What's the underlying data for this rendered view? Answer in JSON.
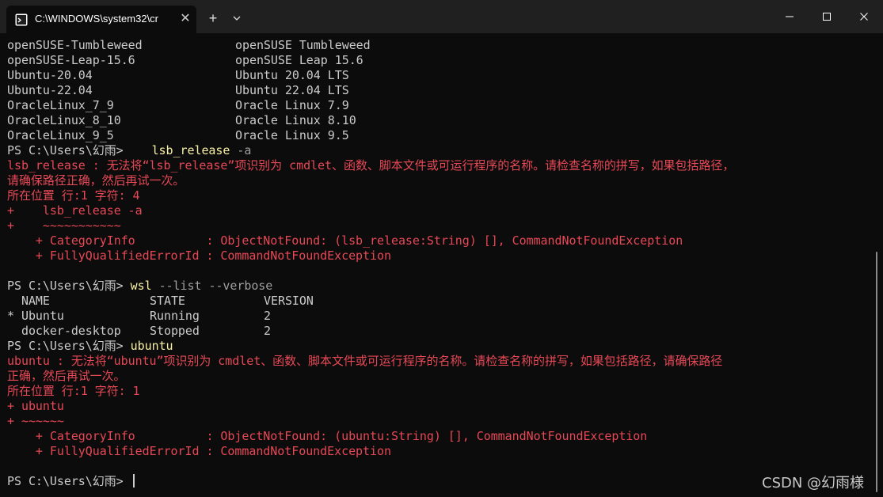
{
  "window": {
    "tab_title": "C:\\WINDOWS\\system32\\cr",
    "close_glyph": "✕",
    "new_tab_glyph": "+"
  },
  "distros": [
    {
      "name": "openSUSE-Tumbleweed",
      "friendly": "openSUSE Tumbleweed"
    },
    {
      "name": "openSUSE-Leap-15.6",
      "friendly": "openSUSE Leap 15.6"
    },
    {
      "name": "Ubuntu-20.04",
      "friendly": "Ubuntu 20.04 LTS"
    },
    {
      "name": "Ubuntu-22.04",
      "friendly": "Ubuntu 22.04 LTS"
    },
    {
      "name": "OracleLinux_7_9",
      "friendly": "Oracle Linux 7.9"
    },
    {
      "name": "OracleLinux_8_10",
      "friendly": "Oracle Linux 8.10"
    },
    {
      "name": "OracleLinux_9_5",
      "friendly": "Oracle Linux 9.5"
    }
  ],
  "prompt": "PS C:\\Users\\幻雨> ",
  "cmd1": {
    "prompt": "PS C:\\Users\\幻雨>    ",
    "command": "lsb_release",
    "args": " -a",
    "error_line1": "lsb_release : 无法将“lsb_release”项识别为 cmdlet、函数、脚本文件或可运行程序的名称。请检查名称的拼写，如果包括路径，",
    "error_line2": "请确保路径正确，然后再试一次。",
    "position": "所在位置 行:1 字符: 4",
    "echo": "+    lsb_release -a",
    "marker": "+    ~~~~~~~~~~~",
    "category": "    + CategoryInfo          : ObjectNotFound: (lsb_release:String) [], CommandNotFoundException",
    "fqid": "    + FullyQualifiedErrorId : CommandNotFoundException"
  },
  "cmd2": {
    "command": "wsl",
    "args": " --list --verbose",
    "headers": [
      "  NAME",
      "STATE",
      "VERSION"
    ],
    "rows": [
      {
        "name": "* Ubuntu",
        "state": "Running",
        "version": "2"
      },
      {
        "name": "  docker-desktop",
        "state": "Stopped",
        "version": "2"
      }
    ]
  },
  "cmd3": {
    "command": "ubuntu",
    "error_line1": "ubuntu : 无法将“ubuntu”项识别为 cmdlet、函数、脚本文件或可运行程序的名称。请检查名称的拼写，如果包括路径，请确保路径",
    "error_line2": "正确，然后再试一次。",
    "position": "所在位置 行:1 字符: 1",
    "echo": "+ ubuntu",
    "marker": "+ ~~~~~~",
    "category": "    + CategoryInfo          : ObjectNotFound: (ubuntu:String) [], CommandNotFoundException",
    "fqid": "    + FullyQualifiedErrorId : CommandNotFoundException"
  },
  "final_prompt": "PS C:\\Users\\幻雨> ",
  "watermark": "CSDN @幻雨様",
  "colors": {
    "background": "#0c0c0c",
    "text": "#cccccc",
    "error": "#e74856",
    "command": "#f9f1a5",
    "parameter": "#a0a0a0"
  }
}
